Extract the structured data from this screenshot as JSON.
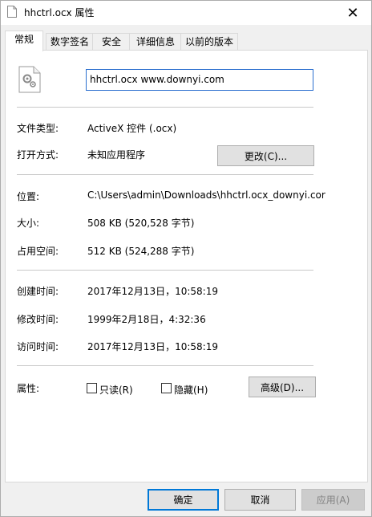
{
  "window": {
    "title": "hhctrl.ocx 属性",
    "close_glyph": "✕"
  },
  "tabs": [
    {
      "label": "常规",
      "active": true
    },
    {
      "label": "数字签名"
    },
    {
      "label": "安全"
    },
    {
      "label": "详细信息"
    },
    {
      "label": "以前的版本"
    }
  ],
  "general": {
    "file_name": "hhctrl.ocx www.downyi.com",
    "type_label": "文件类型:",
    "type_value": "ActiveX 控件 (.ocx)",
    "opens_label": "打开方式:",
    "opens_value": "未知应用程序",
    "change_button": "更改(C)...",
    "location_label": "位置:",
    "location_value": "C:\\Users\\admin\\Downloads\\hhctrl.ocx_downyi.cor",
    "size_label": "大小:",
    "size_value": "508 KB (520,528 字节)",
    "disk_label": "占用空间:",
    "disk_value": "512 KB (524,288 字节)",
    "created_label": "创建时间:",
    "created_value": "2017年12月13日，10:58:19",
    "modified_label": "修改时间:",
    "modified_value": "1999年2月18日，4:32:36",
    "accessed_label": "访问时间:",
    "accessed_value": "2017年12月13日，10:58:19",
    "attr_label": "属性:",
    "readonly_label": "只读(R)",
    "hidden_label": "隐藏(H)",
    "advanced_button": "高级(D)..."
  },
  "footer": {
    "ok": "确定",
    "cancel": "取消",
    "apply": "应用(A)"
  },
  "colors": {
    "accent": "#0078d7",
    "input_border": "#2b6fcf"
  }
}
